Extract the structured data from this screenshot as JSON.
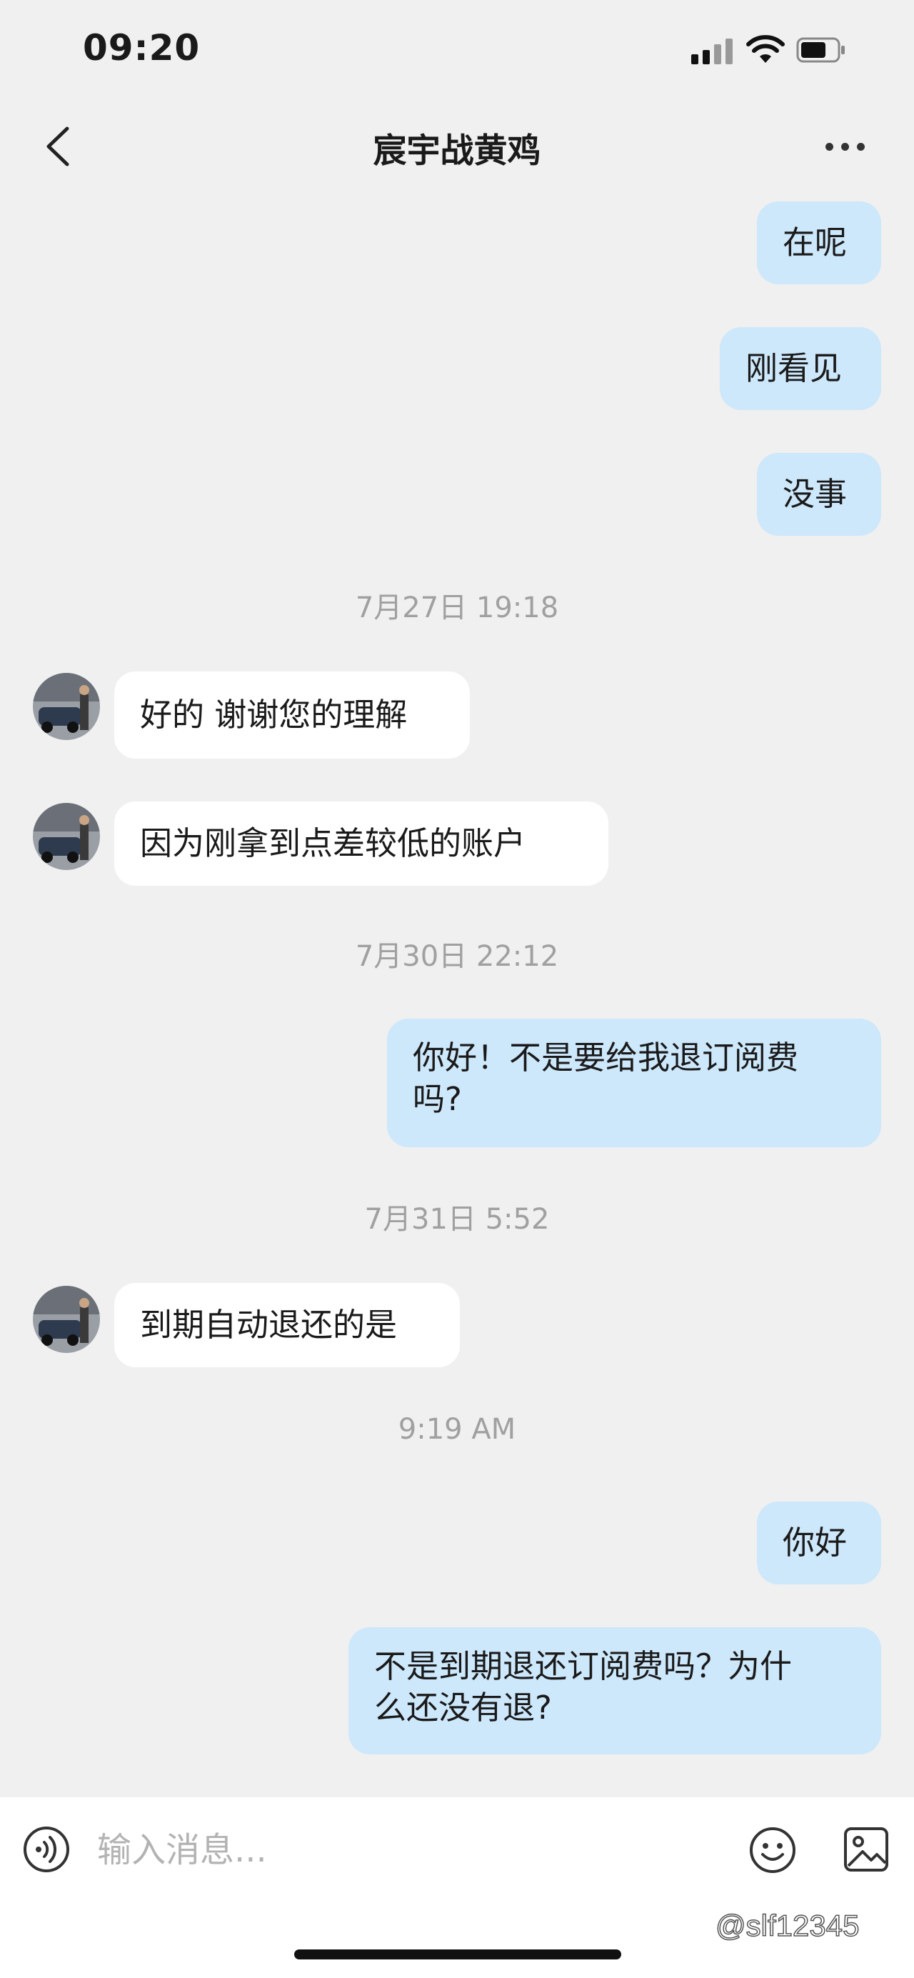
{
  "status_bar": {
    "time": "09:20"
  },
  "header": {
    "title": "宸宇战黄鸡"
  },
  "messages": [
    {
      "text": "在呢"
    },
    {
      "text": "刚看见"
    },
    {
      "text": "没事"
    },
    {
      "text": "7月27日 19:18"
    },
    {
      "text": "好的 谢谢您的理解"
    },
    {
      "text": "因为刚拿到点差较低的账户"
    },
    {
      "text": "7月30日 22:12"
    },
    {
      "text": "你好！不是要给我退订阅费",
      "text2": "吗?"
    },
    {
      "text": "7月31日 5:52"
    },
    {
      "text": "到期自动退还的是"
    },
    {
      "text": "9:19 AM"
    },
    {
      "text": "你好"
    },
    {
      "text": "不是到期退还订阅费吗？为什",
      "text2": "么还没有退?"
    }
  ],
  "input_bar": {
    "placeholder": "输入消息..."
  },
  "watermark": "@slf12345",
  "colors": {
    "outgoing_bubble": "#cde7fb",
    "incoming_bubble": "#ffffff",
    "background": "#f0f0f0"
  }
}
